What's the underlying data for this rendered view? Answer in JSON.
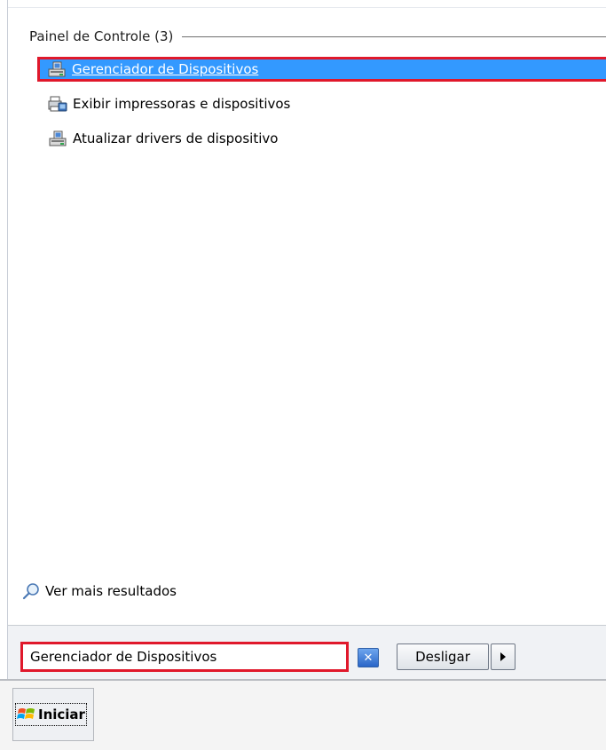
{
  "results": {
    "group_title": "Painel de Controle (3)",
    "items": [
      {
        "label": "Gerenciador de Dispositivos",
        "icon": "device-manager-icon",
        "selected": true
      },
      {
        "label": "Exibir impressoras e dispositivos",
        "icon": "printers-devices-icon",
        "selected": false
      },
      {
        "label": "Atualizar drivers de dispositivo",
        "icon": "device-driver-icon",
        "selected": false
      }
    ],
    "see_more": "Ver mais resultados"
  },
  "search": {
    "value": "Gerenciador de Dispositivos"
  },
  "shutdown": {
    "label": "Desligar"
  },
  "taskbar": {
    "start_label": "Iniciar"
  },
  "colors": {
    "selection": "#3399ff",
    "highlight_border": "#e0182b"
  }
}
